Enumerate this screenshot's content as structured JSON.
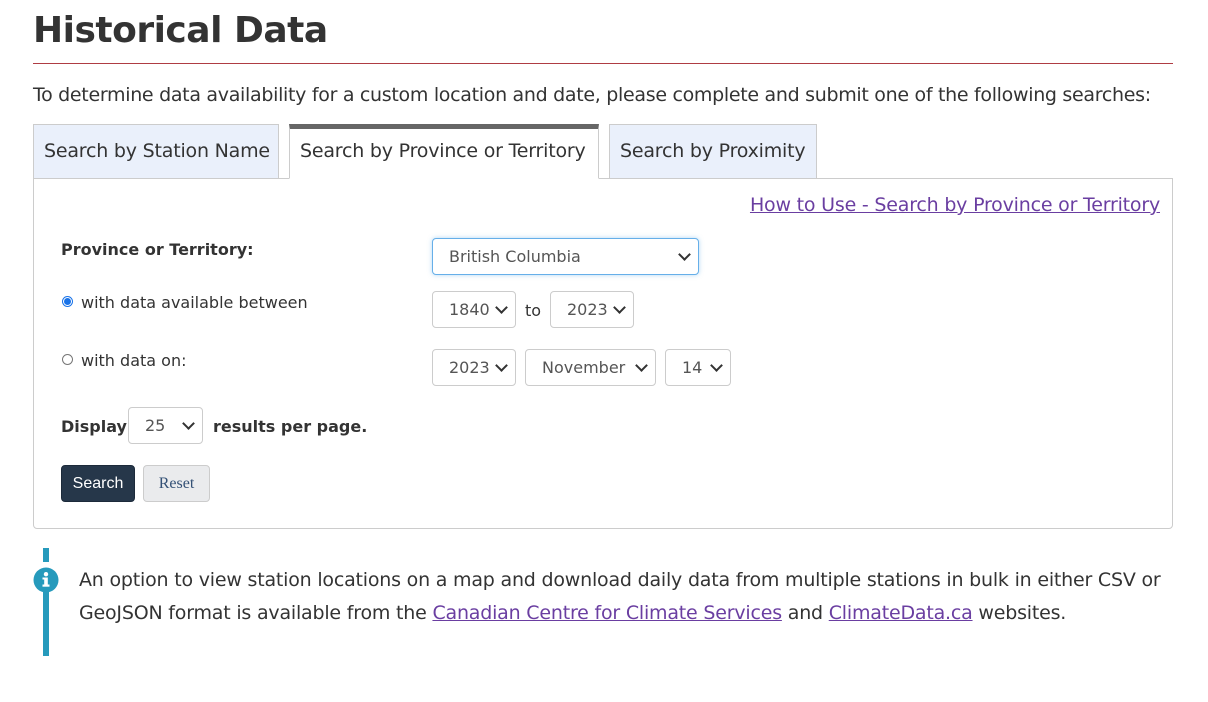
{
  "page": {
    "title": "Historical Data",
    "intro": "To determine data availability for a custom location and date, please complete and submit one of the following searches:"
  },
  "tabs": [
    {
      "label": "Search by Station Name",
      "active": false
    },
    {
      "label": "Search by Province or Territory",
      "active": true
    },
    {
      "label": "Search by Proximity",
      "active": false
    }
  ],
  "form": {
    "help_link": "How to Use - Search by Province or Territory",
    "province_label": "Province or Territory:",
    "province_value": "British Columbia",
    "range_option_label": "with data available between",
    "range_checked": true,
    "range_start": "1840",
    "range_to": "to",
    "range_end": "2023",
    "on_option_label": "with data on:",
    "on_checked": false,
    "on_year": "2023",
    "on_month": "November",
    "on_day": "14",
    "display_label": "Display",
    "display_value": "25",
    "per_page_label": "results per page.",
    "search_button": "Search",
    "reset_button": "Reset"
  },
  "info": {
    "icon": "info-circle-icon",
    "text_before": "An option to view station locations on a map and download daily data from multiple stations in bulk in either CSV or GeoJSON format is available from the ",
    "link1": "Canadian Centre for Climate Services",
    "text_middle": " and ",
    "link2": "ClimateData.ca",
    "text_after": " websites."
  },
  "colors": {
    "title_rule": "#af3c43",
    "tab_inactive_bg": "#eaf0fb",
    "link": "#6a3ea1",
    "primary_button": "#26374a",
    "info_accent": "#269abc"
  }
}
